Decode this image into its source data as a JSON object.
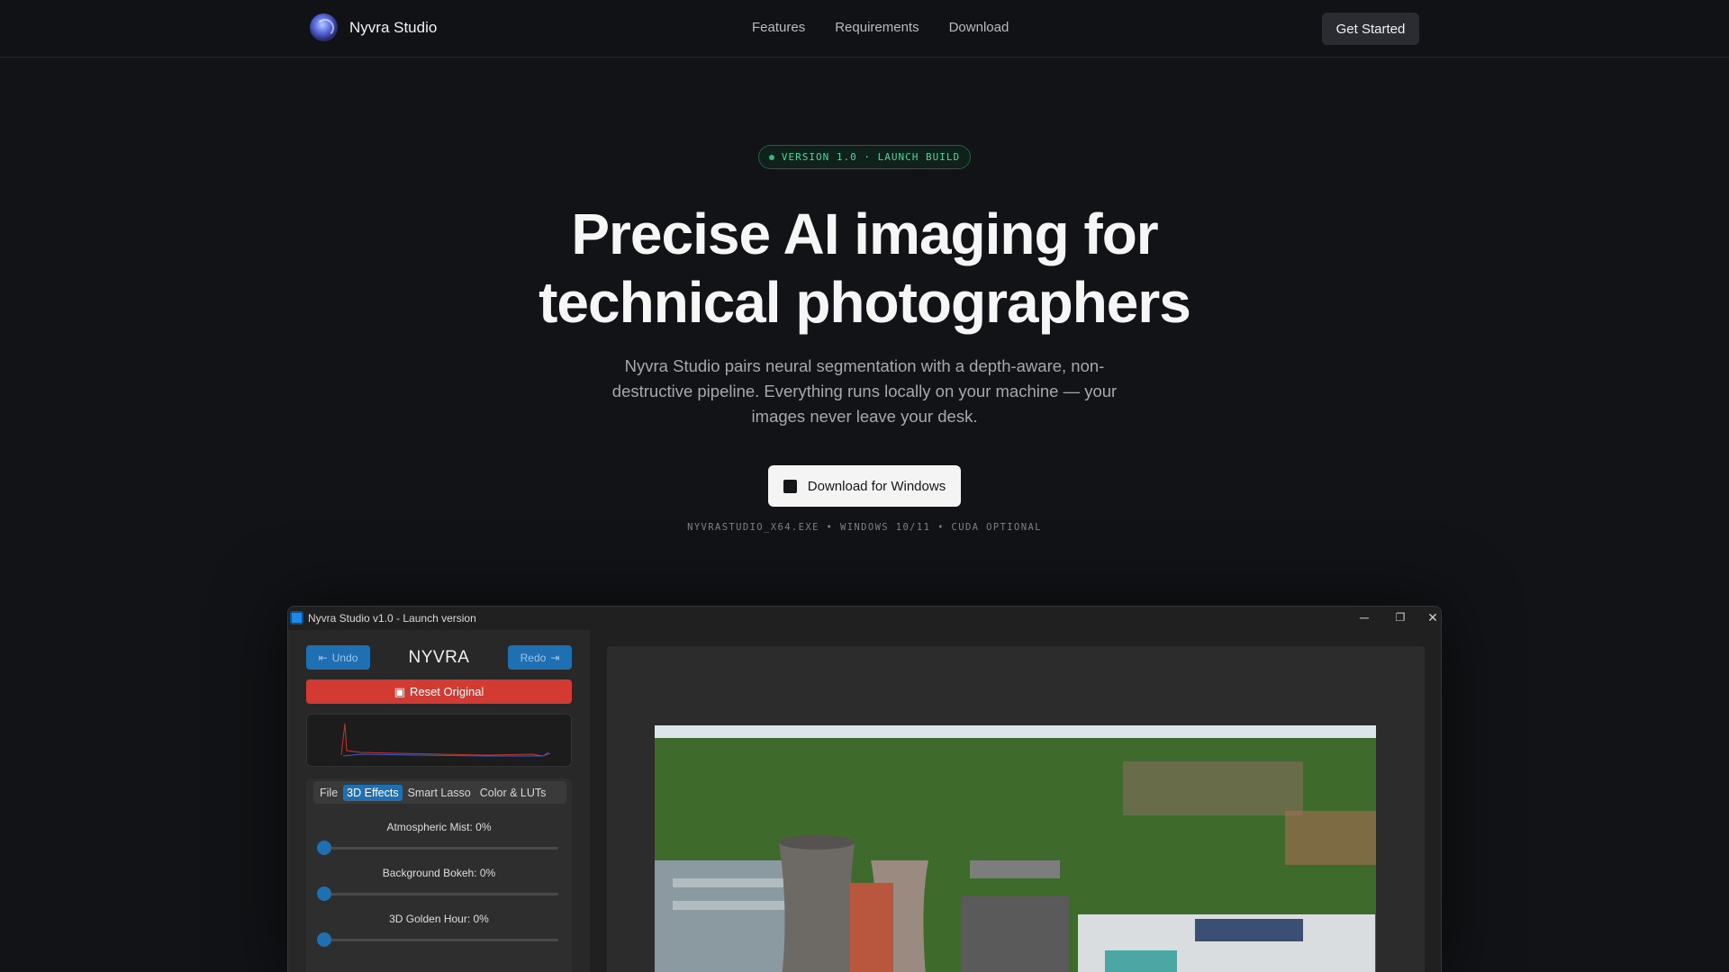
{
  "nav": {
    "brand": "Nyvra Studio",
    "links": [
      "Features",
      "Requirements",
      "Download"
    ],
    "cta": "Get Started",
    "logo_icon": "nyvra-orb-logo"
  },
  "hero": {
    "badge": "VERSION 1.0 · LAUNCH BUILD",
    "title_line1": "Precise AI imaging for",
    "title_line2": "technical photographers",
    "subtitle": "Nyvra Studio pairs neural segmentation with a depth-aware, non-destructive pipeline. Everything runs locally on your machine — your images never leave your desk.",
    "download_label": "Download for Windows",
    "file_meta": "NYVRASTUDIO_X64.EXE • WINDOWS 10/11 • CUDA OPTIONAL"
  },
  "app": {
    "window_title": "Nyvra Studio v1.0 - Launch version",
    "controls": [
      "─",
      "❐",
      "✕"
    ],
    "undo": "Undo",
    "redo": "Redo",
    "logo_text": "NYVRA",
    "reset": "Reset Original",
    "tabs": [
      "File",
      "3D Effects",
      "Smart Lasso",
      "Color & LUTs"
    ],
    "active_tab": "3D Effects",
    "sliders": [
      {
        "label": "Atmospheric Mist: 0%",
        "value": 0
      },
      {
        "label": "Background Bokeh: 0%",
        "value": 0
      },
      {
        "label": "3D Golden Hour: 0%",
        "value": 0
      }
    ]
  },
  "colors": {
    "background": "#121316",
    "accent_green": "#4fd3a0",
    "app_blue": "#1f6fb3",
    "reset_red": "#d23a32"
  }
}
